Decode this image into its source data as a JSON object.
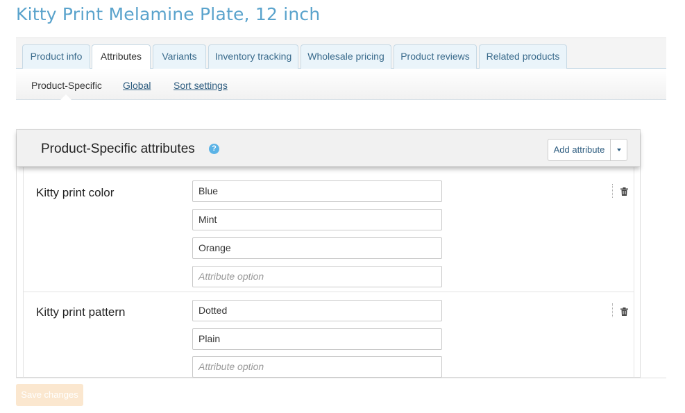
{
  "page": {
    "title": "Kitty Print Melamine Plate, 12 inch"
  },
  "tabs": [
    {
      "label": "Product info",
      "active": false
    },
    {
      "label": "Attributes",
      "active": true
    },
    {
      "label": "Variants",
      "active": false
    },
    {
      "label": "Inventory tracking",
      "active": false
    },
    {
      "label": "Wholesale pricing",
      "active": false
    },
    {
      "label": "Product reviews",
      "active": false
    },
    {
      "label": "Related products",
      "active": false
    }
  ],
  "subnav": [
    {
      "label": "Product-Specific",
      "active": true
    },
    {
      "label": "Global",
      "active": false
    },
    {
      "label": "Sort settings",
      "active": false
    }
  ],
  "panel": {
    "title": "Product-Specific attributes",
    "help_symbol": "?",
    "add_button_label": "Add attribute"
  },
  "attributes": [
    {
      "name": "Kitty print color",
      "options": [
        "Blue",
        "Mint",
        "Orange"
      ],
      "placeholder": "Attribute option"
    },
    {
      "name": "Kitty print pattern",
      "options": [
        "Dotted",
        "Plain"
      ],
      "placeholder": "Attribute option"
    }
  ],
  "footer": {
    "save_label": "Save changes",
    "save_disabled": true
  },
  "colors": {
    "title": "#5aa3cc",
    "link": "#2d5c7f",
    "help": "#5bb3e6",
    "save_disabled_bg": "#fbe7cf"
  }
}
